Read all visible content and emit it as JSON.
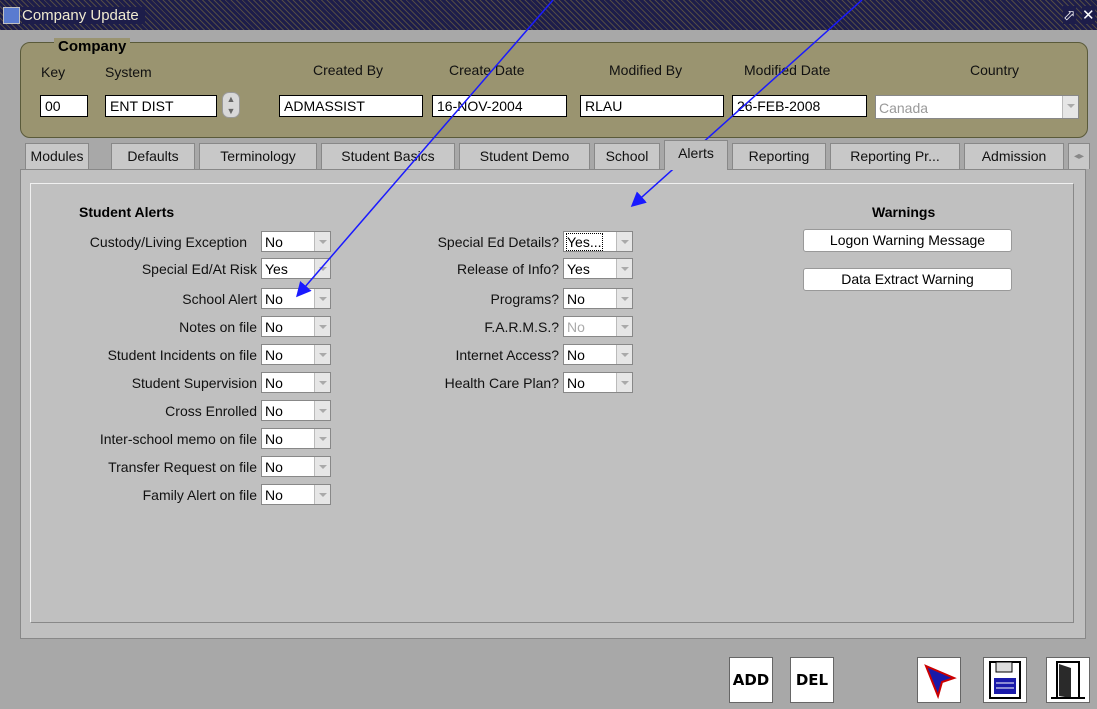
{
  "window": {
    "title": "Company Update"
  },
  "company": {
    "group_label": "Company",
    "headers": {
      "key": "Key",
      "system": "System",
      "created_by": "Created By",
      "create_date": "Create Date",
      "modified_by": "Modified By",
      "modified_date": "Modified Date",
      "country": "Country"
    },
    "key": "00",
    "system": "ENT DIST",
    "created_by": "ADMASSIST",
    "create_date": "16-NOV-2004",
    "modified_by": "RLAU",
    "modified_date": "26-FEB-2008",
    "country": "Canada"
  },
  "tabs": [
    "Modules",
    "Defaults",
    "Terminology",
    "Student Basics",
    "Student Demo",
    "School",
    "Alerts",
    "Reporting",
    "Reporting Pr...",
    "Admission"
  ],
  "active_tab": "Alerts",
  "student_alerts": {
    "header": "Student Alerts",
    "items": [
      {
        "label": "Custody/Living Exception",
        "value": "No"
      },
      {
        "label": "Special Ed/At Risk",
        "value": "Yes"
      },
      {
        "label": "School Alert",
        "value": "No"
      },
      {
        "label": "Notes on file",
        "value": "No"
      },
      {
        "label": "Student Incidents on file",
        "value": "No"
      },
      {
        "label": "Student Supervision",
        "value": "No"
      },
      {
        "label": "Cross Enrolled",
        "value": "No"
      },
      {
        "label": "Inter-school memo on file",
        "value": "No"
      },
      {
        "label": "Transfer Request on file",
        "value": "No"
      },
      {
        "label": "Family Alert on file",
        "value": "No"
      }
    ]
  },
  "other_alerts": {
    "items": [
      {
        "label": "Special Ed Details?",
        "value": "Yes..."
      },
      {
        "label": "Release of Info?",
        "value": "Yes"
      },
      {
        "label": "Programs?",
        "value": "No"
      },
      {
        "label": "F.A.R.M.S.?",
        "value": "No"
      },
      {
        "label": "Internet Access?",
        "value": "No"
      },
      {
        "label": "Health Care Plan?",
        "value": "No"
      }
    ]
  },
  "warnings": {
    "header": "Warnings",
    "logon_button": "Logon Warning Message",
    "extract_button": "Data Extract Warning"
  },
  "toolbar": {
    "add": "ADD",
    "del": "DEL"
  },
  "colors": {
    "arrow": "#1a1aff",
    "titlebar": "#1d1d4a"
  }
}
